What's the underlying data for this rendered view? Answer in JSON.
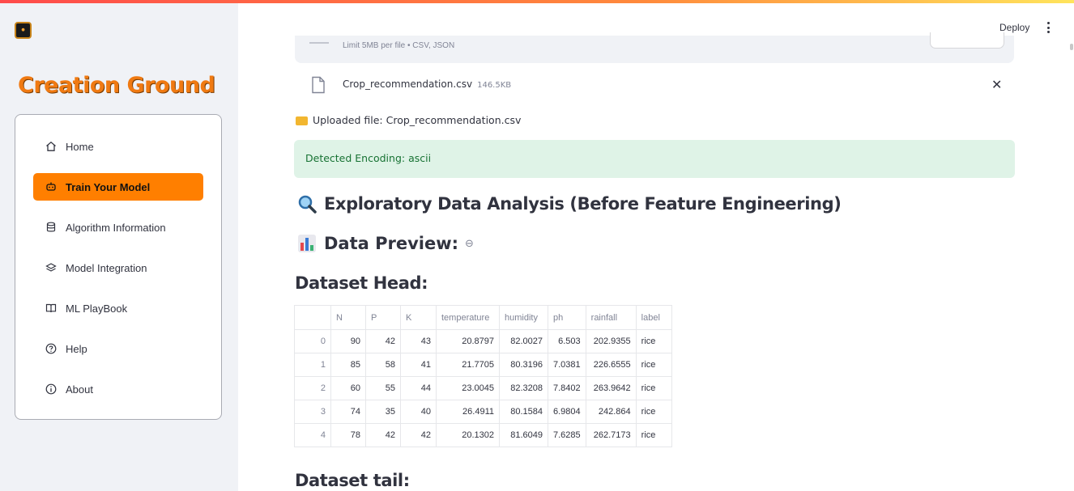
{
  "app": {
    "brand": "Creation Ground",
    "logo_text": "CREATION GROUND",
    "deploy_label": "Deploy"
  },
  "sidebar": {
    "items": [
      {
        "label": "Home",
        "icon": "home-icon",
        "active": false
      },
      {
        "label": "Train Your Model",
        "icon": "robot-icon",
        "active": true
      },
      {
        "label": "Algorithm Information",
        "icon": "database-icon",
        "active": false
      },
      {
        "label": "Model Integration",
        "icon": "layers-icon",
        "active": false
      },
      {
        "label": "ML PlayBook",
        "icon": "book-icon",
        "active": false
      },
      {
        "label": "Help",
        "icon": "question-circle-icon",
        "active": false
      },
      {
        "label": "About",
        "icon": "info-circle-icon",
        "active": false
      }
    ],
    "active_color": "#ff7f00"
  },
  "uploader": {
    "limit_text": "Limit 5MB per file • CSV, JSON",
    "file_name": "Crop_recommendation.csv",
    "file_size": "146.5KB"
  },
  "status": {
    "uploaded_text": "Uploaded file: Crop_recommendation.csv",
    "encoding_text": "Detected Encoding: ascii"
  },
  "headings": {
    "eda": "Exploratory Data Analysis (Before Feature Engineering)",
    "preview": "Data Preview:",
    "head": "Dataset Head:",
    "tail": "Dataset tail:"
  },
  "table": {
    "columns": [
      "",
      "N",
      "P",
      "K",
      "temperature",
      "humidity",
      "ph",
      "rainfall",
      "label"
    ],
    "rows": [
      [
        "0",
        "90",
        "42",
        "43",
        "20.8797",
        "82.0027",
        "6.503",
        "202.9355",
        "rice"
      ],
      [
        "1",
        "85",
        "58",
        "41",
        "21.7705",
        "80.3196",
        "7.0381",
        "226.6555",
        "rice"
      ],
      [
        "2",
        "60",
        "55",
        "44",
        "23.0045",
        "82.3208",
        "7.8402",
        "263.9642",
        "rice"
      ],
      [
        "3",
        "74",
        "35",
        "40",
        "26.4911",
        "80.1584",
        "6.9804",
        "242.864",
        "rice"
      ],
      [
        "4",
        "78",
        "42",
        "42",
        "20.1302",
        "81.6049",
        "7.6285",
        "262.7173",
        "rice"
      ]
    ]
  }
}
